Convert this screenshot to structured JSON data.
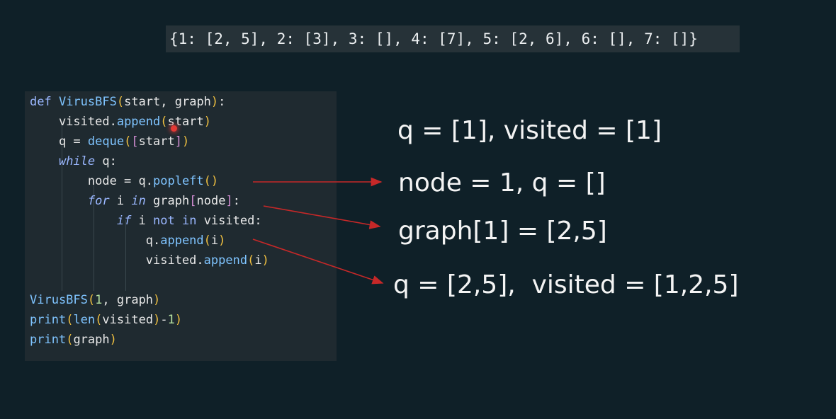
{
  "graph_output": "{1: [2, 5], 2: [3], 3: [], 4: [7], 5: [2, 6], 6: [], 7: []}",
  "code": {
    "lines": [
      [
        {
          "t": "def ",
          "c": "kw"
        },
        {
          "t": "VirusBFS",
          "c": "fn"
        },
        {
          "t": "(",
          "c": "paren"
        },
        {
          "t": "start, graph",
          "c": "var"
        },
        {
          "t": ")",
          "c": "paren"
        },
        {
          "t": ":",
          "c": "op"
        }
      ],
      [
        {
          "t": "    visited.",
          "c": "var"
        },
        {
          "t": "append",
          "c": "fn"
        },
        {
          "t": "(",
          "c": "paren"
        },
        {
          "t": "start",
          "c": "var"
        },
        {
          "t": ")",
          "c": "paren"
        }
      ],
      [
        {
          "t": "    q = ",
          "c": "var"
        },
        {
          "t": "deque",
          "c": "fn"
        },
        {
          "t": "(",
          "c": "paren"
        },
        {
          "t": "[",
          "c": "brack"
        },
        {
          "t": "start",
          "c": "var"
        },
        {
          "t": "]",
          "c": "brack"
        },
        {
          "t": ")",
          "c": "paren"
        }
      ],
      [
        {
          "t": "    ",
          "c": "var"
        },
        {
          "t": "while",
          "c": "kw-it"
        },
        {
          "t": " q:",
          "c": "var"
        }
      ],
      [
        {
          "t": "        node = q.",
          "c": "var"
        },
        {
          "t": "popleft",
          "c": "fn"
        },
        {
          "t": "()",
          "c": "paren"
        }
      ],
      [
        {
          "t": "        ",
          "c": "var"
        },
        {
          "t": "for",
          "c": "kw-it"
        },
        {
          "t": " i ",
          "c": "var"
        },
        {
          "t": "in",
          "c": "kw-it"
        },
        {
          "t": " graph",
          "c": "var"
        },
        {
          "t": "[",
          "c": "brack"
        },
        {
          "t": "node",
          "c": "var"
        },
        {
          "t": "]",
          "c": "brack"
        },
        {
          "t": ":",
          "c": "op"
        }
      ],
      [
        {
          "t": "            ",
          "c": "var"
        },
        {
          "t": "if",
          "c": "kw-it"
        },
        {
          "t": " i ",
          "c": "var"
        },
        {
          "t": "not in",
          "c": "kw"
        },
        {
          "t": " visited:",
          "c": "var"
        }
      ],
      [
        {
          "t": "                q.",
          "c": "var"
        },
        {
          "t": "append",
          "c": "fn"
        },
        {
          "t": "(",
          "c": "paren"
        },
        {
          "t": "i",
          "c": "var"
        },
        {
          "t": ")",
          "c": "paren"
        }
      ],
      [
        {
          "t": "                visited.",
          "c": "var"
        },
        {
          "t": "append",
          "c": "fn"
        },
        {
          "t": "(",
          "c": "paren"
        },
        {
          "t": "i",
          "c": "var"
        },
        {
          "t": ")",
          "c": "paren"
        }
      ],
      [],
      [
        {
          "t": "VirusBFS",
          "c": "fn"
        },
        {
          "t": "(",
          "c": "paren"
        },
        {
          "t": "1",
          "c": "num"
        },
        {
          "t": ", graph",
          "c": "var"
        },
        {
          "t": ")",
          "c": "paren"
        }
      ],
      [
        {
          "t": "print",
          "c": "fn"
        },
        {
          "t": "(",
          "c": "paren"
        },
        {
          "t": "len",
          "c": "fn"
        },
        {
          "t": "(",
          "c": "paren"
        },
        {
          "t": "visited",
          "c": "var"
        },
        {
          "t": ")",
          "c": "paren"
        },
        {
          "t": "-",
          "c": "op"
        },
        {
          "t": "1",
          "c": "num"
        },
        {
          "t": ")",
          "c": "paren"
        }
      ],
      [
        {
          "t": "print",
          "c": "fn"
        },
        {
          "t": "(",
          "c": "paren"
        },
        {
          "t": "graph",
          "c": "var"
        },
        {
          "t": ")",
          "c": "paren"
        }
      ]
    ]
  },
  "annotations": [
    "q = [1], visited = [1]",
    "node = 1, q = []",
    "graph[1] = [2,5]",
    "q = [2,5],  visited = [1,2,5]"
  ],
  "colors": {
    "background": "#0f2028",
    "code_panel": "#1f2a30",
    "arrow": "#c62828",
    "cursor": "#e53935"
  },
  "icons": {
    "cursor": "pointer-dot-icon"
  }
}
